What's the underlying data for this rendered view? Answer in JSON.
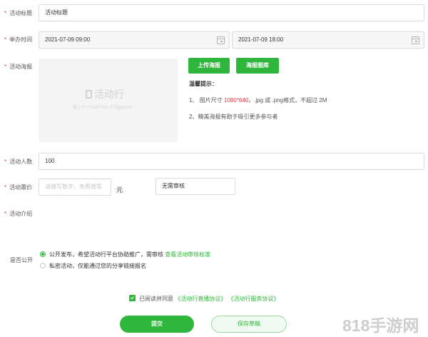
{
  "form": {
    "title": {
      "label": "活动标题",
      "value": "活动标题"
    },
    "time": {
      "label": "举办时间",
      "start": "2021-07-09 09:00",
      "end": "2021-07-09 18:00"
    },
    "poster": {
      "label": "活动海报",
      "logo_text": "活动行",
      "hint_text": "最小尺寸1080*640 支持jpg/png",
      "upload_button": "上传海报",
      "gallery_button": "海报图库",
      "tips_title": "温馨提示：",
      "tip1_prefix": "1、 图片尺寸 ",
      "tip1_size": "1080*640",
      "tip1_suffix": "，.jpg 或 .png格式，不超过 2M",
      "tip2": "2、精美海报有助于吸引更多参与者"
    },
    "capacity": {
      "label": "活动人数",
      "value": "100"
    },
    "price": {
      "label": "活动票价",
      "placeholder": "请填写数字，免费填零",
      "unit": "元",
      "review_value": "无需审核"
    },
    "intro": {
      "label": "活动介绍"
    },
    "visibility": {
      "label": "是否公开",
      "option_public": "公开发布，希望活动行平台协助推广，需审核",
      "option_public_link": "查看活动审核标准",
      "option_private": "私密活动，仅能通过您的分享链接报名",
      "selected": "public"
    },
    "agreement": {
      "prefix": "已阅读并同意",
      "link1": "《活动行直播协议》",
      "link2": "《活动行服务协议》",
      "checked": true
    },
    "submit_button": "提交",
    "draft_button": "保存草稿"
  },
  "watermark": "818手游网",
  "colors": {
    "accent": "#2fb63c",
    "required": "#e4393c",
    "highlight": "#e4393c"
  },
  "icons": {
    "calendar": "calendar-icon",
    "check": "checkbox-check-icon"
  }
}
